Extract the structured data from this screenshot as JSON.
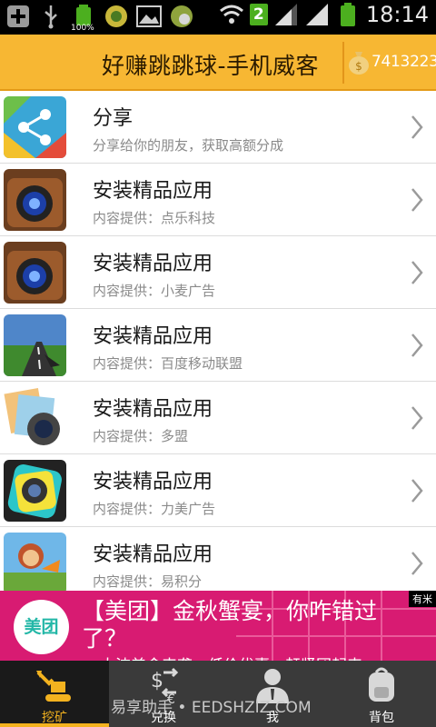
{
  "status_bar": {
    "time": "18:14",
    "sim_badge": "2",
    "battery_label": "100%",
    "icons": [
      "plus-icon",
      "usb-icon",
      "battery-icon",
      "app-icon",
      "image-icon",
      "app2-icon",
      "wifi-icon",
      "signal-icon",
      "signal-icon",
      "battery-icon"
    ]
  },
  "header": {
    "title": "好赚跳跳球-手机威客",
    "coins": "7413223",
    "color": "#f7b733"
  },
  "list": [
    {
      "title": "分享",
      "subtitle": "分享给你的朋友，获取高额分成",
      "icon": "share-icon"
    },
    {
      "title": "安装精品应用",
      "subtitle": "内容提供：点乐科技",
      "icon": "camera-app-icon"
    },
    {
      "title": "安装精品应用",
      "subtitle": "内容提供：小麦广告",
      "icon": "camera-app-icon"
    },
    {
      "title": "安装精品应用",
      "subtitle": "内容提供：百度移动联盟",
      "icon": "navigation-app-icon"
    },
    {
      "title": "安装精品应用",
      "subtitle": "内容提供：多盟",
      "icon": "photo-app-icon"
    },
    {
      "title": "安装精品应用",
      "subtitle": "内容提供：力美广告",
      "icon": "camera-app-icon"
    },
    {
      "title": "安装精品应用",
      "subtitle": "内容提供：易积分",
      "icon": "game-app-icon"
    }
  ],
  "ad": {
    "logo": "美团",
    "text": "【美团】金秋蟹宴，你咋错过了？",
    "sub": "大波美食来袭，低价优惠，赶紧团起来",
    "badge": "有米",
    "color": "#d81b72"
  },
  "tabs": [
    {
      "label": "挖矿",
      "icon": "excavator-icon",
      "active": true
    },
    {
      "label": "兑换",
      "icon": "exchange-icon",
      "active": false
    },
    {
      "label": "我",
      "icon": "user-icon",
      "active": false
    },
    {
      "label": "背包",
      "icon": "backpack-icon",
      "active": false
    }
  ],
  "watermark": "易享助手 • EEDSHZIZ.COM"
}
